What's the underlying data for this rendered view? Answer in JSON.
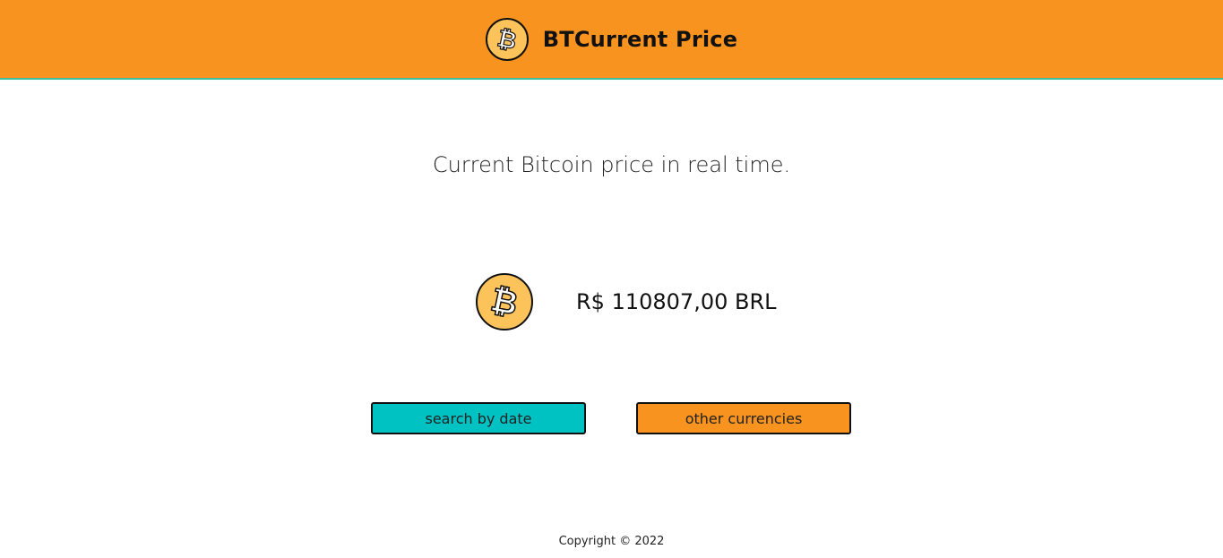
{
  "header": {
    "title": "BTCurrent Price",
    "logo_icon": "bitcoin-icon",
    "background_color": "#f7931e",
    "accent_border_color": "#3fbf9f"
  },
  "main": {
    "subtitle": "Current Bitcoin price in real time.",
    "price_icon": "bitcoin-icon",
    "price": "R$ 110807,00 BRL"
  },
  "actions": {
    "search_by_date_label": "search by date",
    "search_by_date_color": "#00c2c2",
    "other_currencies_label": "other currencies",
    "other_currencies_color": "#f7931e"
  },
  "footer": {
    "copyright": "Copyright © 2022"
  }
}
